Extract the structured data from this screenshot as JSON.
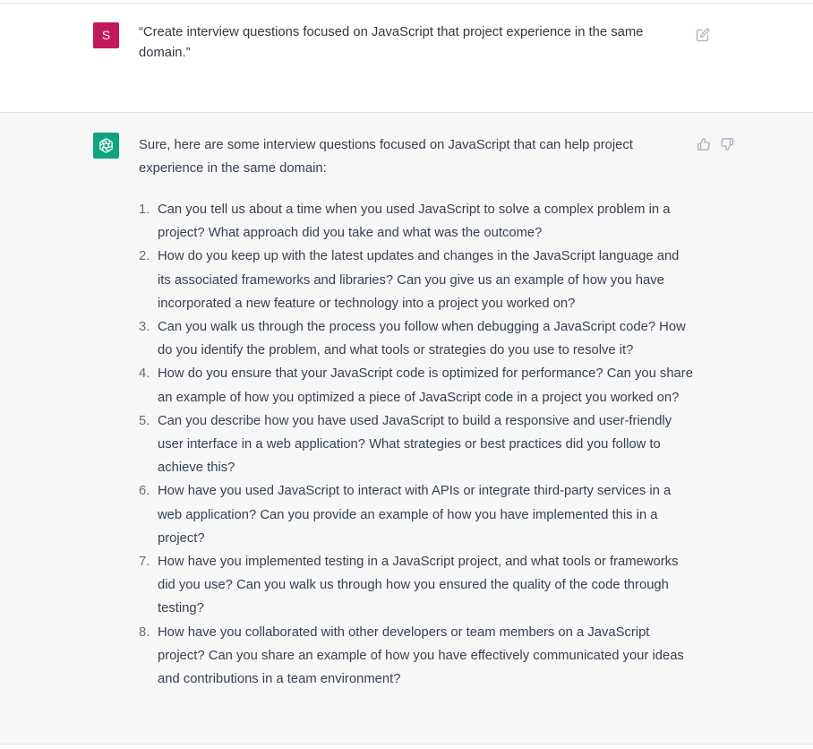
{
  "user_message": {
    "avatar_initial": "S",
    "avatar_color": "#c2185b",
    "text": "“Create interview questions focused on JavaScript that project experience in the same domain.”",
    "edit_icon": "edit-icon"
  },
  "assistant_message": {
    "avatar_icon": "openai-logo-icon",
    "avatar_color": "#10a37f",
    "intro": "Sure, here are some interview questions focused on JavaScript that can help project experience in the same domain:",
    "feedback_icons": [
      "thumbs-up-icon",
      "thumbs-down-icon"
    ],
    "questions": [
      {
        "num": "1.",
        "text": "Can you tell us about a time when you used JavaScript to solve a complex problem in a project? What approach did you take and what was the outcome?"
      },
      {
        "num": "2.",
        "text": "How do you keep up with the latest updates and changes in the JavaScript language and its associated frameworks and libraries? Can you give us an example of how you have incorporated a new feature or technology into a project you worked on?"
      },
      {
        "num": "3.",
        "text": "Can you walk us through the process you follow when debugging a JavaScript code? How do you identify the problem, and what tools or strategies do you use to resolve it?"
      },
      {
        "num": "4.",
        "text": "How do you ensure that your JavaScript code is optimized for performance? Can you share an example of how you optimized a piece of JavaScript code in a project you worked on?"
      },
      {
        "num": "5.",
        "text": "Can you describe how you have used JavaScript to build a responsive and user-friendly user interface in a web application? What strategies or best practices did you follow to achieve this?"
      },
      {
        "num": "6.",
        "text": "How have you used JavaScript to interact with APIs or integrate third-party services in a web application? Can you provide an example of how you have implemented this in a project?"
      },
      {
        "num": "7.",
        "text": "How have you implemented testing in a JavaScript project, and what tools or frameworks did you use? Can you walk us through how you ensured the quality of the code through testing?"
      },
      {
        "num": "8.",
        "text": "How have you collaborated with other developers or team members on a JavaScript project? Can you share an example of how you have effectively communicated your ideas and contributions in a team environment?"
      }
    ]
  }
}
